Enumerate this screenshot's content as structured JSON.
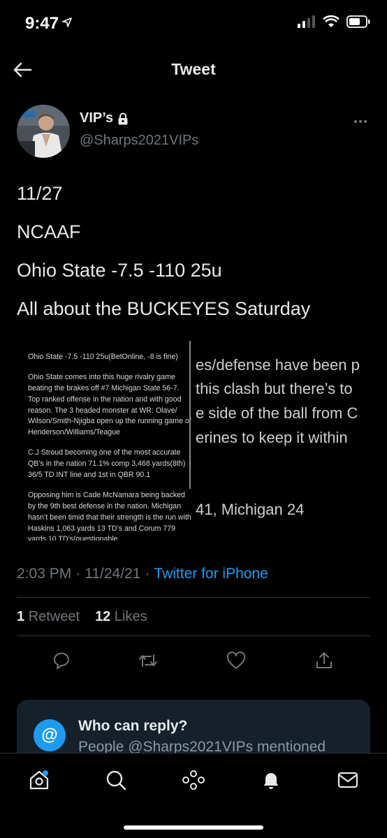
{
  "status_bar": {
    "time": "9:47"
  },
  "nav": {
    "title": "Tweet"
  },
  "author": {
    "display_name": "VIP’s",
    "handle": "@Sharps2021VIPs"
  },
  "tweet": {
    "lines": [
      "11/27",
      "NCAAF",
      "Ohio State -7.5 -110 25u",
      "All about the BUCKEYES Saturday"
    ]
  },
  "media": {
    "doc_paragraphs": [
      "Ohio State -7.5 -110 25u(BetOnline, -8 is fine)",
      "Ohio State comes into this huge rivalry game beating the brakes off #7 Michigan State 56-7. Top ranked offense in the nation and with good reason. The 3 headed monster at WR: Olave/ Wilson/Smith-Njigba open up the running game of Henderson/Williams/Teague",
      "C.J Stroud becoming one of the most accurate QB’s in the nation 71.1% comp 3,468 yards(8th) 36/5 TD INT line and 1st in QBR 90.1",
      "Opposing him is Cade McNamara being backed by the 9th best defense in the nation. Michigan hasn’t been timid that their strength is the run with Haskins 1,063 yards 13 TD’s and Corum 779 yards 10 TD’s(questionable"
    ],
    "notes_lines": [
      "es/defense have been p",
      " this clash but there’s to",
      "e side of the ball from C",
      "erines to keep it within ",
      "41, Michigan 24"
    ]
  },
  "meta": {
    "time": "2:03 PM",
    "dot1": "·",
    "date": "11/24/21",
    "dot2": "·",
    "source": "Twitter for iPhone"
  },
  "stats": {
    "retweets_count": "1",
    "retweets_label": "Retweet",
    "likes_count": "12",
    "likes_label": "Likes"
  },
  "reply_card": {
    "icon": "@",
    "title": "Who can reply?",
    "subtitle": "People @Sharps2021VIPs mentioned"
  },
  "colors": {
    "accent": "#1d9bf0",
    "background": "#000000",
    "muted": "#71767b",
    "card": "#15202b"
  }
}
